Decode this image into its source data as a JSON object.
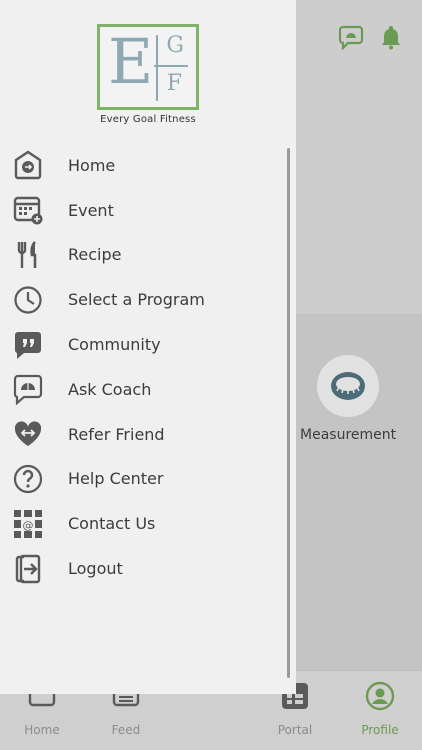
{
  "logo": {
    "letter_big": "E",
    "letter_g": "G",
    "letter_f": "F",
    "tagline": "Every Goal Fitness"
  },
  "menu": [
    {
      "label": "Home",
      "icon": "home-icon"
    },
    {
      "label": "Event",
      "icon": "calendar-icon"
    },
    {
      "label": "Recipe",
      "icon": "fork-knife-icon"
    },
    {
      "label": "Select a Program",
      "icon": "clock-icon"
    },
    {
      "label": "Community",
      "icon": "quote-chat-icon"
    },
    {
      "label": "Ask Coach",
      "icon": "coach-chat-icon"
    },
    {
      "label": "Refer Friend",
      "icon": "heart-arrows-icon"
    },
    {
      "label": "Help Center",
      "icon": "question-icon"
    },
    {
      "label": "Contact Us",
      "icon": "at-grid-icon"
    },
    {
      "label": "Logout",
      "icon": "logout-icon"
    }
  ],
  "background": {
    "measurement_label": "Measurement",
    "bottom_nav": [
      {
        "label": "Home"
      },
      {
        "label": "Feed"
      },
      {
        "label": "Portal"
      },
      {
        "label": "Profile",
        "active": true
      }
    ]
  },
  "colors": {
    "accent": "#6b9a52",
    "drawer_bg": "#f0f0f0",
    "icon": "#5a5a5a"
  }
}
